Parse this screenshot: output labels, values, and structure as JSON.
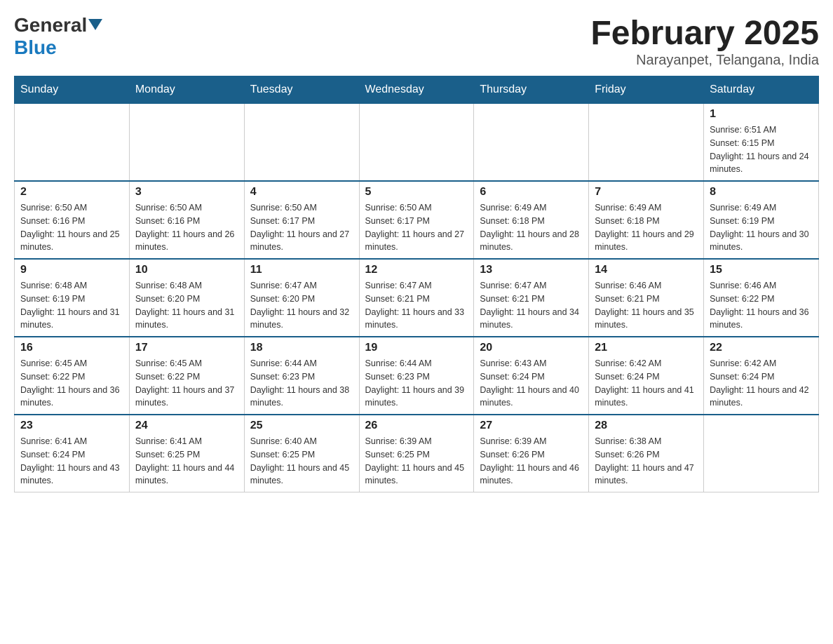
{
  "header": {
    "logo_general": "General",
    "logo_blue": "Blue",
    "title": "February 2025",
    "subtitle": "Narayanpet, Telangana, India"
  },
  "days_of_week": [
    "Sunday",
    "Monday",
    "Tuesday",
    "Wednesday",
    "Thursday",
    "Friday",
    "Saturday"
  ],
  "weeks": [
    {
      "days": [
        {
          "number": "",
          "info": ""
        },
        {
          "number": "",
          "info": ""
        },
        {
          "number": "",
          "info": ""
        },
        {
          "number": "",
          "info": ""
        },
        {
          "number": "",
          "info": ""
        },
        {
          "number": "",
          "info": ""
        },
        {
          "number": "1",
          "info": "Sunrise: 6:51 AM\nSunset: 6:15 PM\nDaylight: 11 hours and 24 minutes."
        }
      ]
    },
    {
      "days": [
        {
          "number": "2",
          "info": "Sunrise: 6:50 AM\nSunset: 6:16 PM\nDaylight: 11 hours and 25 minutes."
        },
        {
          "number": "3",
          "info": "Sunrise: 6:50 AM\nSunset: 6:16 PM\nDaylight: 11 hours and 26 minutes."
        },
        {
          "number": "4",
          "info": "Sunrise: 6:50 AM\nSunset: 6:17 PM\nDaylight: 11 hours and 27 minutes."
        },
        {
          "number": "5",
          "info": "Sunrise: 6:50 AM\nSunset: 6:17 PM\nDaylight: 11 hours and 27 minutes."
        },
        {
          "number": "6",
          "info": "Sunrise: 6:49 AM\nSunset: 6:18 PM\nDaylight: 11 hours and 28 minutes."
        },
        {
          "number": "7",
          "info": "Sunrise: 6:49 AM\nSunset: 6:18 PM\nDaylight: 11 hours and 29 minutes."
        },
        {
          "number": "8",
          "info": "Sunrise: 6:49 AM\nSunset: 6:19 PM\nDaylight: 11 hours and 30 minutes."
        }
      ]
    },
    {
      "days": [
        {
          "number": "9",
          "info": "Sunrise: 6:48 AM\nSunset: 6:19 PM\nDaylight: 11 hours and 31 minutes."
        },
        {
          "number": "10",
          "info": "Sunrise: 6:48 AM\nSunset: 6:20 PM\nDaylight: 11 hours and 31 minutes."
        },
        {
          "number": "11",
          "info": "Sunrise: 6:47 AM\nSunset: 6:20 PM\nDaylight: 11 hours and 32 minutes."
        },
        {
          "number": "12",
          "info": "Sunrise: 6:47 AM\nSunset: 6:21 PM\nDaylight: 11 hours and 33 minutes."
        },
        {
          "number": "13",
          "info": "Sunrise: 6:47 AM\nSunset: 6:21 PM\nDaylight: 11 hours and 34 minutes."
        },
        {
          "number": "14",
          "info": "Sunrise: 6:46 AM\nSunset: 6:21 PM\nDaylight: 11 hours and 35 minutes."
        },
        {
          "number": "15",
          "info": "Sunrise: 6:46 AM\nSunset: 6:22 PM\nDaylight: 11 hours and 36 minutes."
        }
      ]
    },
    {
      "days": [
        {
          "number": "16",
          "info": "Sunrise: 6:45 AM\nSunset: 6:22 PM\nDaylight: 11 hours and 36 minutes."
        },
        {
          "number": "17",
          "info": "Sunrise: 6:45 AM\nSunset: 6:22 PM\nDaylight: 11 hours and 37 minutes."
        },
        {
          "number": "18",
          "info": "Sunrise: 6:44 AM\nSunset: 6:23 PM\nDaylight: 11 hours and 38 minutes."
        },
        {
          "number": "19",
          "info": "Sunrise: 6:44 AM\nSunset: 6:23 PM\nDaylight: 11 hours and 39 minutes."
        },
        {
          "number": "20",
          "info": "Sunrise: 6:43 AM\nSunset: 6:24 PM\nDaylight: 11 hours and 40 minutes."
        },
        {
          "number": "21",
          "info": "Sunrise: 6:42 AM\nSunset: 6:24 PM\nDaylight: 11 hours and 41 minutes."
        },
        {
          "number": "22",
          "info": "Sunrise: 6:42 AM\nSunset: 6:24 PM\nDaylight: 11 hours and 42 minutes."
        }
      ]
    },
    {
      "days": [
        {
          "number": "23",
          "info": "Sunrise: 6:41 AM\nSunset: 6:24 PM\nDaylight: 11 hours and 43 minutes."
        },
        {
          "number": "24",
          "info": "Sunrise: 6:41 AM\nSunset: 6:25 PM\nDaylight: 11 hours and 44 minutes."
        },
        {
          "number": "25",
          "info": "Sunrise: 6:40 AM\nSunset: 6:25 PM\nDaylight: 11 hours and 45 minutes."
        },
        {
          "number": "26",
          "info": "Sunrise: 6:39 AM\nSunset: 6:25 PM\nDaylight: 11 hours and 45 minutes."
        },
        {
          "number": "27",
          "info": "Sunrise: 6:39 AM\nSunset: 6:26 PM\nDaylight: 11 hours and 46 minutes."
        },
        {
          "number": "28",
          "info": "Sunrise: 6:38 AM\nSunset: 6:26 PM\nDaylight: 11 hours and 47 minutes."
        },
        {
          "number": "",
          "info": ""
        }
      ]
    }
  ]
}
